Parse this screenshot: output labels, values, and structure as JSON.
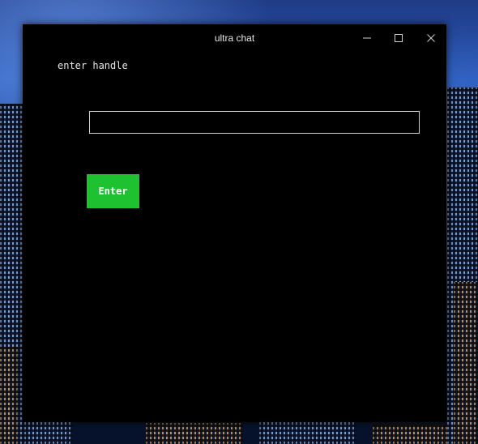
{
  "window": {
    "title": "ultra chat"
  },
  "form": {
    "label": "enter handle",
    "input_value": "",
    "input_placeholder": "",
    "button_label": "Enter"
  },
  "icons": {
    "minimize": "minimize-icon",
    "maximize": "maximize-icon",
    "close": "close-icon"
  },
  "colors": {
    "window_bg": "#000000",
    "text": "#e6e6e6",
    "button_bg": "#1ec12f",
    "input_border": "#d0d0d0"
  }
}
